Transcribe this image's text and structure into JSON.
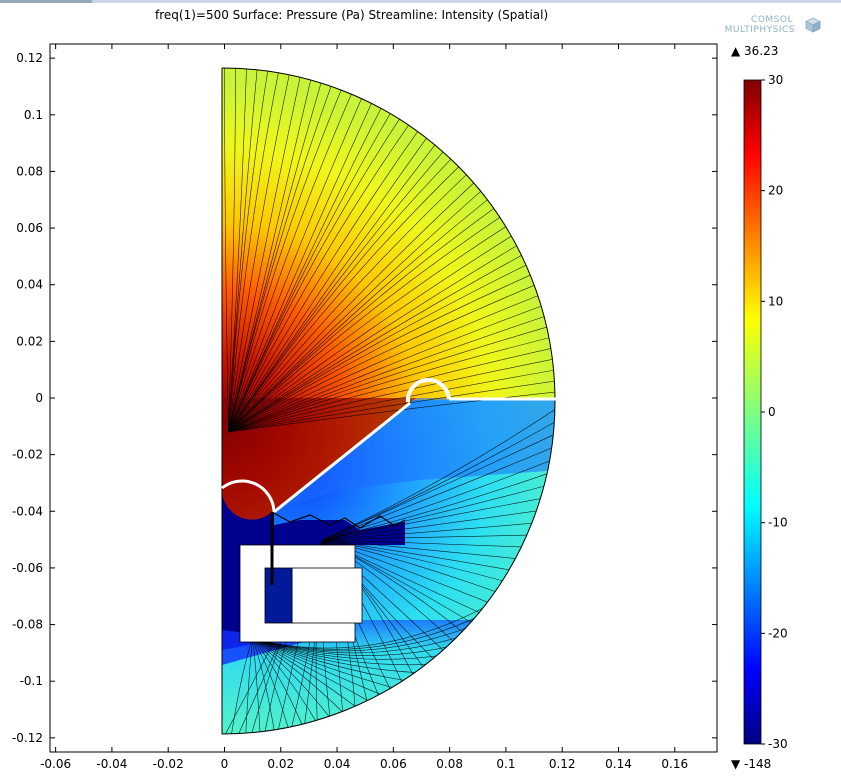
{
  "plot": {
    "title": "freq(1)=500  Surface: Pressure (Pa) Streamline: Intensity (Spatial)"
  },
  "logo": {
    "line1": "COMSOL",
    "line2": "MULTIPHYSICS"
  },
  "colorbar": {
    "max_marker": "▲ 36.23",
    "min_marker": "▼ -148",
    "max_value": 36.23,
    "min_value": -148,
    "range": [
      -30,
      30
    ],
    "ticks": [
      30,
      20,
      10,
      0,
      -10,
      -20,
      -30
    ],
    "colormap": "jet"
  },
  "chart_data": {
    "type": "heatmap",
    "title": "freq(1)=500  Surface: Pressure (Pa) Streamline: Intensity (Spatial)",
    "xlabel": "",
    "ylabel": "",
    "xlim": [
      -0.062,
      0.175
    ],
    "ylim": [
      -0.125,
      0.125
    ],
    "x_ticks": [
      -0.06,
      -0.04,
      -0.02,
      0,
      0.02,
      0.04,
      0.06,
      0.08,
      0.1,
      0.12,
      0.14,
      0.16
    ],
    "x_tick_labels": [
      "-0.06",
      "-0.04",
      "-0.02",
      "0",
      "0.02",
      "0.04",
      "0.06",
      "0.08",
      "0.1",
      "0.12",
      "0.14",
      "0.16"
    ],
    "y_ticks": [
      0.12,
      0.1,
      0.08,
      0.06,
      0.04,
      0.02,
      0,
      -0.02,
      -0.04,
      -0.06,
      -0.08,
      -0.1,
      -0.12
    ],
    "y_tick_labels": [
      "0.12",
      "0.1",
      "0.08",
      "0.06",
      "0.04",
      "0.02",
      "0",
      "-0.02",
      "-0.04",
      "-0.06",
      "-0.08",
      "-0.1",
      "-0.12"
    ],
    "grid": false,
    "domain": {
      "shape": "half-disk",
      "radius": 0.12,
      "center": [
        0,
        0
      ],
      "horn_sphere_center": [
        0.073,
        0.002
      ],
      "horn_sphere_radius": 0.0075,
      "horn_mouth_y": -0.033
    },
    "surface": {
      "quantity": "Pressure (Pa)",
      "unit": "Pa",
      "regions": [
        {
          "name": "upper-horn-front",
          "value_range": [
            10,
            30
          ]
        },
        {
          "name": "outer-upper",
          "value_range": [
            0,
            12
          ]
        },
        {
          "name": "outer-lower",
          "value_range": [
            -8,
            -2
          ]
        },
        {
          "name": "horn-interior",
          "value_range": [
            -30,
            -10
          ]
        }
      ]
    },
    "streamline": {
      "quantity": "Intensity (Spatial)"
    }
  }
}
